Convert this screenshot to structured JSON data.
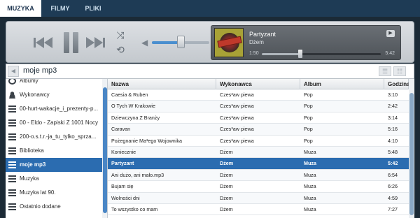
{
  "tabs": [
    {
      "label": "MUZYKA",
      "active": true
    },
    {
      "label": "FILMY",
      "active": false
    },
    {
      "label": "PLIKI",
      "active": false
    }
  ],
  "player": {
    "volume": 0.55,
    "now_playing": {
      "title": "Partyzant",
      "artist": "Dżem",
      "elapsed": "1:50",
      "total": "5:42",
      "progress": 0.32
    }
  },
  "pathbar": {
    "title": "moje mp3"
  },
  "sidebar": {
    "items": [
      {
        "label": "Albumy",
        "icon": "album-icon"
      },
      {
        "label": "Wykonawcy",
        "icon": "artist-icon"
      },
      {
        "label": "00-hurt-wakacje_i_prezenty-p...",
        "icon": "playlist-icon"
      },
      {
        "label": "00 - Eldo - Zapiski Z 1001 Nocy",
        "icon": "playlist-icon"
      },
      {
        "label": "200-o.s.t.r.-ja_tu_tylko_sprza...",
        "icon": "playlist-icon"
      },
      {
        "label": "Biblioteka",
        "icon": "playlist-icon"
      },
      {
        "label": "moje mp3",
        "icon": "playlist-icon",
        "selected": true
      },
      {
        "label": "Muzyka",
        "icon": "playlist-icon"
      },
      {
        "label": "Muzyka lat 90.",
        "icon": "playlist-icon"
      },
      {
        "label": "Ostatnio dodane",
        "icon": "playlist-icon"
      }
    ]
  },
  "table": {
    "columns": [
      "Nazwa",
      "Wykonawca",
      "Album",
      "Godzina"
    ],
    "rows": [
      [
        "Caesia & Ruben",
        "Czes³aw piewa",
        "Pop",
        "3:10"
      ],
      [
        "O Tych W Krakowie",
        "Czes³aw piewa",
        "Pop",
        "2:42"
      ],
      [
        "Dziewczyna Z Branży",
        "Czes³aw piewa",
        "Pop",
        "3:14"
      ],
      [
        "Caravan",
        "Czes³aw piewa",
        "Pop",
        "5:16"
      ],
      [
        "Pożegnanie Ma³ego Wojownika",
        "Czes³aw piewa",
        "Pop",
        "4:10"
      ],
      [
        "Koniecznie",
        "Dżem",
        "Muza",
        "5:48"
      ],
      [
        "Partyzant",
        "Dżem",
        "Muza",
        "5:42"
      ],
      [
        "Ani dużo, ani mało.mp3",
        "Dżem",
        "Muza",
        "6:54"
      ],
      [
        "Bujam się",
        "Dżem",
        "Muza",
        "6:26"
      ],
      [
        "Wolności dni",
        "Dżem",
        "Muza",
        "4:59"
      ],
      [
        "To wszystko co mam",
        "Dżem",
        "Muza",
        "7:27"
      ]
    ],
    "selected_index": 6
  }
}
